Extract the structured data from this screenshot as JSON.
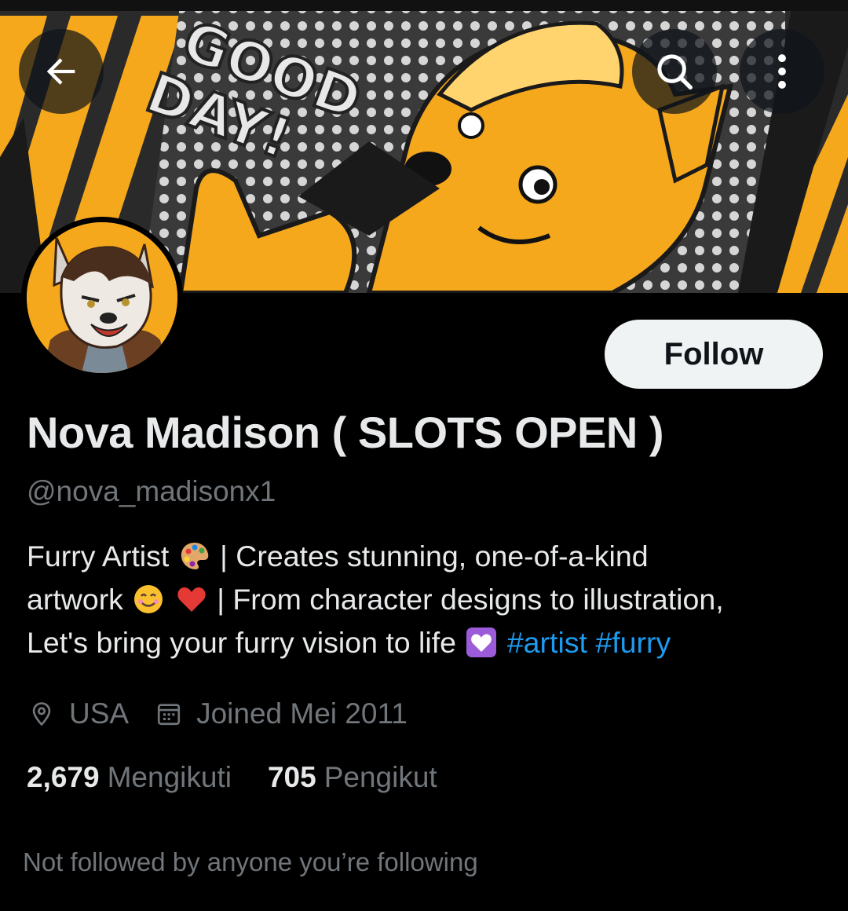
{
  "banner": {
    "text_line1": "GOOD",
    "text_line2": "DAY!",
    "accent_color": "#f6a81c"
  },
  "top_bar": {
    "back_icon": "arrow-left-icon",
    "search_icon": "search-icon",
    "more_icon": "more-vertical-icon"
  },
  "profile": {
    "display_name": "Nova Madison ( SLOTS OPEN )",
    "handle": "@nova_madisonx1",
    "follow_label": "Follow",
    "bio": {
      "line1_a": "Furry Artist",
      "line1_b": "| Creates stunning, one-of-a-kind",
      "line2_a": "artwork",
      "line2_b": "| From character designs to illustration,",
      "line3_a": "Let's bring your furry vision to life",
      "hashtag1": "#artist",
      "hashtag2": "#furry"
    },
    "location": "USA",
    "joined": "Joined Mei 2011",
    "following_count": "2,679",
    "following_label": "Mengikuti",
    "followers_count": "705",
    "followers_label": "Pengikut",
    "followed_by_note": "Not followed by anyone you’re following"
  },
  "colors": {
    "background": "#000000",
    "text_primary": "#e7e9ea",
    "text_secondary": "#71767b",
    "link": "#1d9bf0",
    "button_bg": "#eff3f4"
  }
}
